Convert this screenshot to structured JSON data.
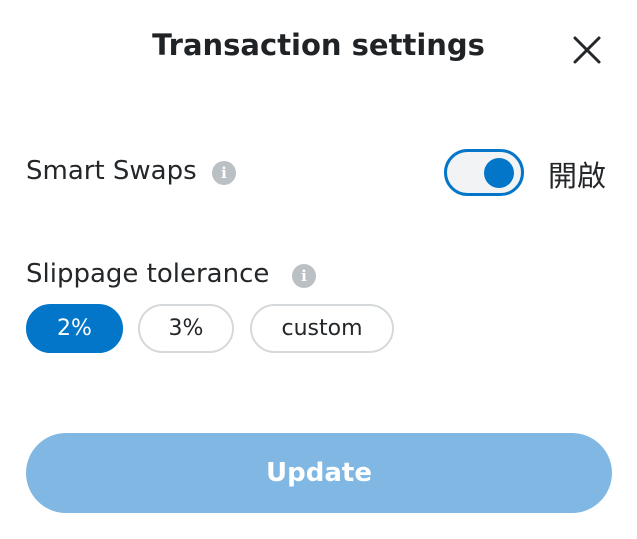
{
  "header": {
    "title": "Transaction settings",
    "close_icon": "close-icon"
  },
  "smart_swaps": {
    "label": "Smart Swaps",
    "info_icon": "info-icon",
    "info_glyph": "i",
    "toggle_on": true,
    "toggle_state_label": "開啟",
    "accent_color": "#0376c9"
  },
  "slippage": {
    "label": "Slippage tolerance",
    "info_icon": "info-icon",
    "info_glyph": "i",
    "options": [
      {
        "label": "2%",
        "selected": true
      },
      {
        "label": "3%",
        "selected": false
      },
      {
        "label": "custom",
        "selected": false
      }
    ]
  },
  "footer": {
    "update_label": "Update",
    "update_color": "#81b7e3",
    "update_disabled": true
  }
}
